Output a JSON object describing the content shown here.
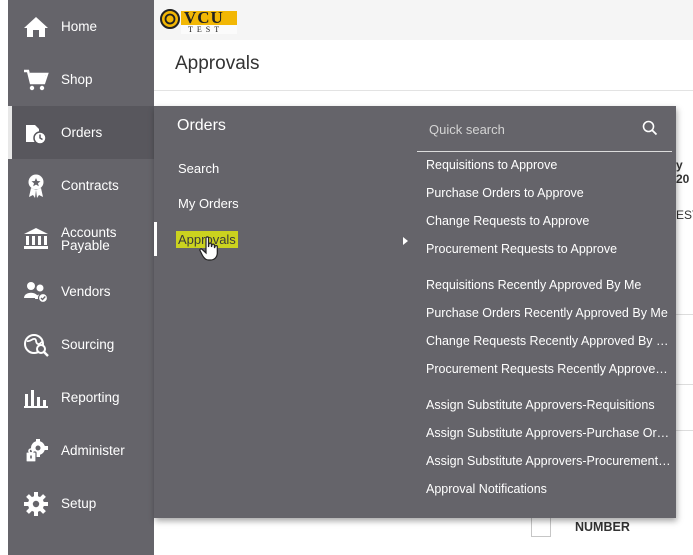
{
  "sidebar": {
    "items": [
      {
        "label": "Home",
        "icon": "home-icon"
      },
      {
        "label": "Shop",
        "icon": "cart-icon"
      },
      {
        "label": "Orders",
        "icon": "orders-icon"
      },
      {
        "label": "Contracts",
        "icon": "ribbon-icon"
      },
      {
        "label": "Accounts Payable",
        "icon": "bank-icon"
      },
      {
        "label": "Vendors",
        "icon": "users-icon"
      },
      {
        "label": "Sourcing",
        "icon": "globe-icon"
      },
      {
        "label": "Reporting",
        "icon": "bar-chart-icon"
      },
      {
        "label": "Administer",
        "icon": "admin-gear-icon"
      },
      {
        "label": "Setup",
        "icon": "gear-icon"
      }
    ]
  },
  "logo": {
    "text": "VCU",
    "subtext": "TEST"
  },
  "page": {
    "title": "Approvals"
  },
  "flyout": {
    "heading": "Orders",
    "submenu": [
      {
        "label": "Search"
      },
      {
        "label": "My Orders"
      },
      {
        "label": "Approvals"
      }
    ],
    "search": {
      "placeholder": "Quick search"
    },
    "links": [
      "Requisitions to Approve",
      "Purchase Orders to Approve",
      "Change Requests to Approve",
      "Procurement Requests to Approve",
      "Requisitions Recently Approved By Me",
      "Purchase Orders Recently Approved By Me",
      "Change Requests Recently Approved By Me",
      "Procurement Requests Recently Approved By Me",
      "Assign Substitute Approvers-Requisitions",
      "Assign Substitute Approvers-Purchase Orders",
      "Assign Substitute Approvers-Procurement Requests",
      "Approval Notifications"
    ]
  },
  "background": {
    "cell1": "y 20",
    "cell2": "EST",
    "column_header": "NUMBER"
  },
  "colors": {
    "sidebar": "#65646a",
    "highlight": "#cbd21f",
    "logo_gold": "#f2b705"
  }
}
